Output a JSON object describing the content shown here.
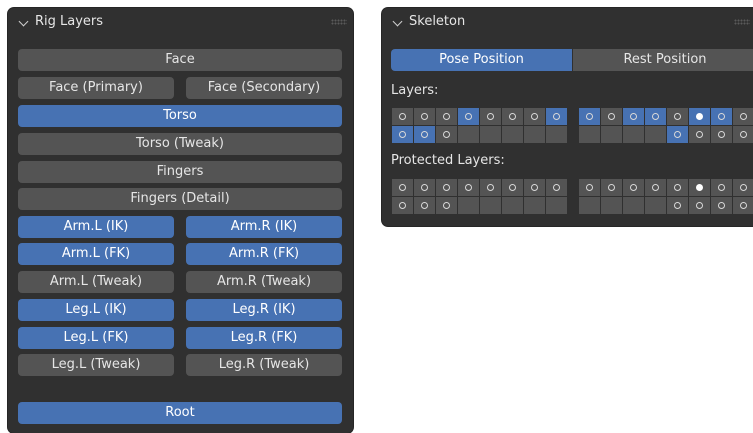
{
  "rig_layers": {
    "title": "Rig Layers",
    "buttons": [
      {
        "label": "Face",
        "active": false
      },
      {
        "label": "Face (Primary)",
        "active": false
      },
      {
        "label": "Face (Secondary)",
        "active": false
      },
      {
        "label": "Torso",
        "active": true
      },
      {
        "label": "Torso (Tweak)",
        "active": false
      },
      {
        "label": "Fingers",
        "active": false
      },
      {
        "label": "Fingers (Detail)",
        "active": false
      },
      {
        "label": "Arm.L (IK)",
        "active": true
      },
      {
        "label": "Arm.R (IK)",
        "active": true
      },
      {
        "label": "Arm.L (FK)",
        "active": true
      },
      {
        "label": "Arm.R (FK)",
        "active": true
      },
      {
        "label": "Arm.L (Tweak)",
        "active": false
      },
      {
        "label": "Arm.R (Tweak)",
        "active": false
      },
      {
        "label": "Leg.L (IK)",
        "active": true
      },
      {
        "label": "Leg.R (IK)",
        "active": true
      },
      {
        "label": "Leg.L (FK)",
        "active": true
      },
      {
        "label": "Leg.R (FK)",
        "active": true
      },
      {
        "label": "Leg.L (Tweak)",
        "active": false
      },
      {
        "label": "Leg.R (Tweak)",
        "active": false
      },
      {
        "label": "Root",
        "active": true
      }
    ]
  },
  "skeleton": {
    "title": "Skeleton",
    "pose_position_label": "Pose Position",
    "rest_position_label": "Rest Position",
    "active_position": "Pose Position",
    "layers_label": "Layers:",
    "protected_layers_label": "Protected Layers:",
    "layers": {
      "group1": {
        "row1": [
          "empty",
          "empty",
          "empty",
          "on",
          "empty",
          "empty",
          "empty",
          "on"
        ],
        "row2": [
          "on",
          "on",
          "empty",
          "blank",
          "blank",
          "blank",
          "blank",
          "blank"
        ]
      },
      "group2": {
        "row1": [
          "on",
          "empty",
          "on",
          "on",
          "empty",
          "on-filled",
          "on",
          "empty"
        ],
        "row2": [
          "blank",
          "blank",
          "blank",
          "blank",
          "on",
          "empty",
          "empty",
          "empty"
        ]
      }
    },
    "protected_layers": {
      "group1": {
        "row1": [
          "empty",
          "empty",
          "empty",
          "empty",
          "empty",
          "empty",
          "empty",
          "empty"
        ],
        "row2": [
          "empty",
          "empty",
          "empty",
          "blank",
          "blank",
          "blank",
          "blank",
          "blank"
        ]
      },
      "group2": {
        "row1": [
          "empty",
          "empty",
          "empty",
          "empty",
          "empty",
          "filled",
          "empty",
          "empty"
        ],
        "row2": [
          "blank",
          "blank",
          "blank",
          "blank",
          "empty",
          "empty",
          "empty",
          "empty"
        ]
      }
    }
  },
  "colors": {
    "panel_bg": "#303030",
    "button_bg": "#545454",
    "active_blue": "#4772b3",
    "text": "#e6e6e6"
  }
}
